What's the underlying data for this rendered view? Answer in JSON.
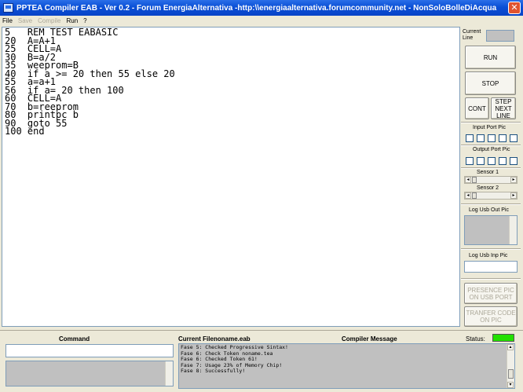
{
  "window": {
    "title": "PPTEA Compiler EAB - Ver 0.2 - Forum EnergiaAlternativa -http:\\\\energiaalternativa.forumcommunity.net  - NonSoloBolleDiAcqua",
    "close_glyph": "✕"
  },
  "menu": {
    "items": [
      "File",
      "Save",
      "Compile",
      "Run",
      "?"
    ]
  },
  "editor": {
    "lines": [
      "5   REM TEST EABASIC",
      "20  A=A+1",
      "25  CELL=A",
      "30  B=a/2",
      "35  weeprom=B",
      "40  if a >= 20 then 55 else 20",
      "55  a=a+1",
      "56  if a= 20 then 100",
      "60  CELL=A",
      "70  b=reeprom",
      "80  printpc b",
      "90  goto 55",
      "100 end"
    ]
  },
  "right_panel": {
    "current_line_label": "Current Line",
    "run_label": "RUN",
    "stop_label": "STOP",
    "cont_label": "CONT",
    "step_label": "STEP NEXT LINE",
    "input_port_label": "Input Port Pic",
    "output_port_label": "Output Port Pic",
    "sensor1_label": "Sensor 1",
    "sensor2_label": "Sensor 2",
    "log_out_label": "Log Usb Out Pic",
    "log_inp_label": "Log Usb Inp Pic",
    "presence_label": "PRESENCE PIC ON USB PORT",
    "transfer_label": "TRANFER CODE ON PIC"
  },
  "bottom": {
    "command_label": "Command",
    "current_file_label": "Current File:",
    "current_file_value": "noname.eab",
    "compiler_message_label": "Compiler Message",
    "status_label": "Status:",
    "messages": [
      "Fase 5: Checked Progressive Sintax!",
      "Fase 6: Check Token noname.tea",
      "Fase 6: Checked Token 61!",
      "Fase 7: Usage 23% of Memory Chip!",
      "Fase 8: Successfully!"
    ],
    "status_color": "#22e000"
  }
}
